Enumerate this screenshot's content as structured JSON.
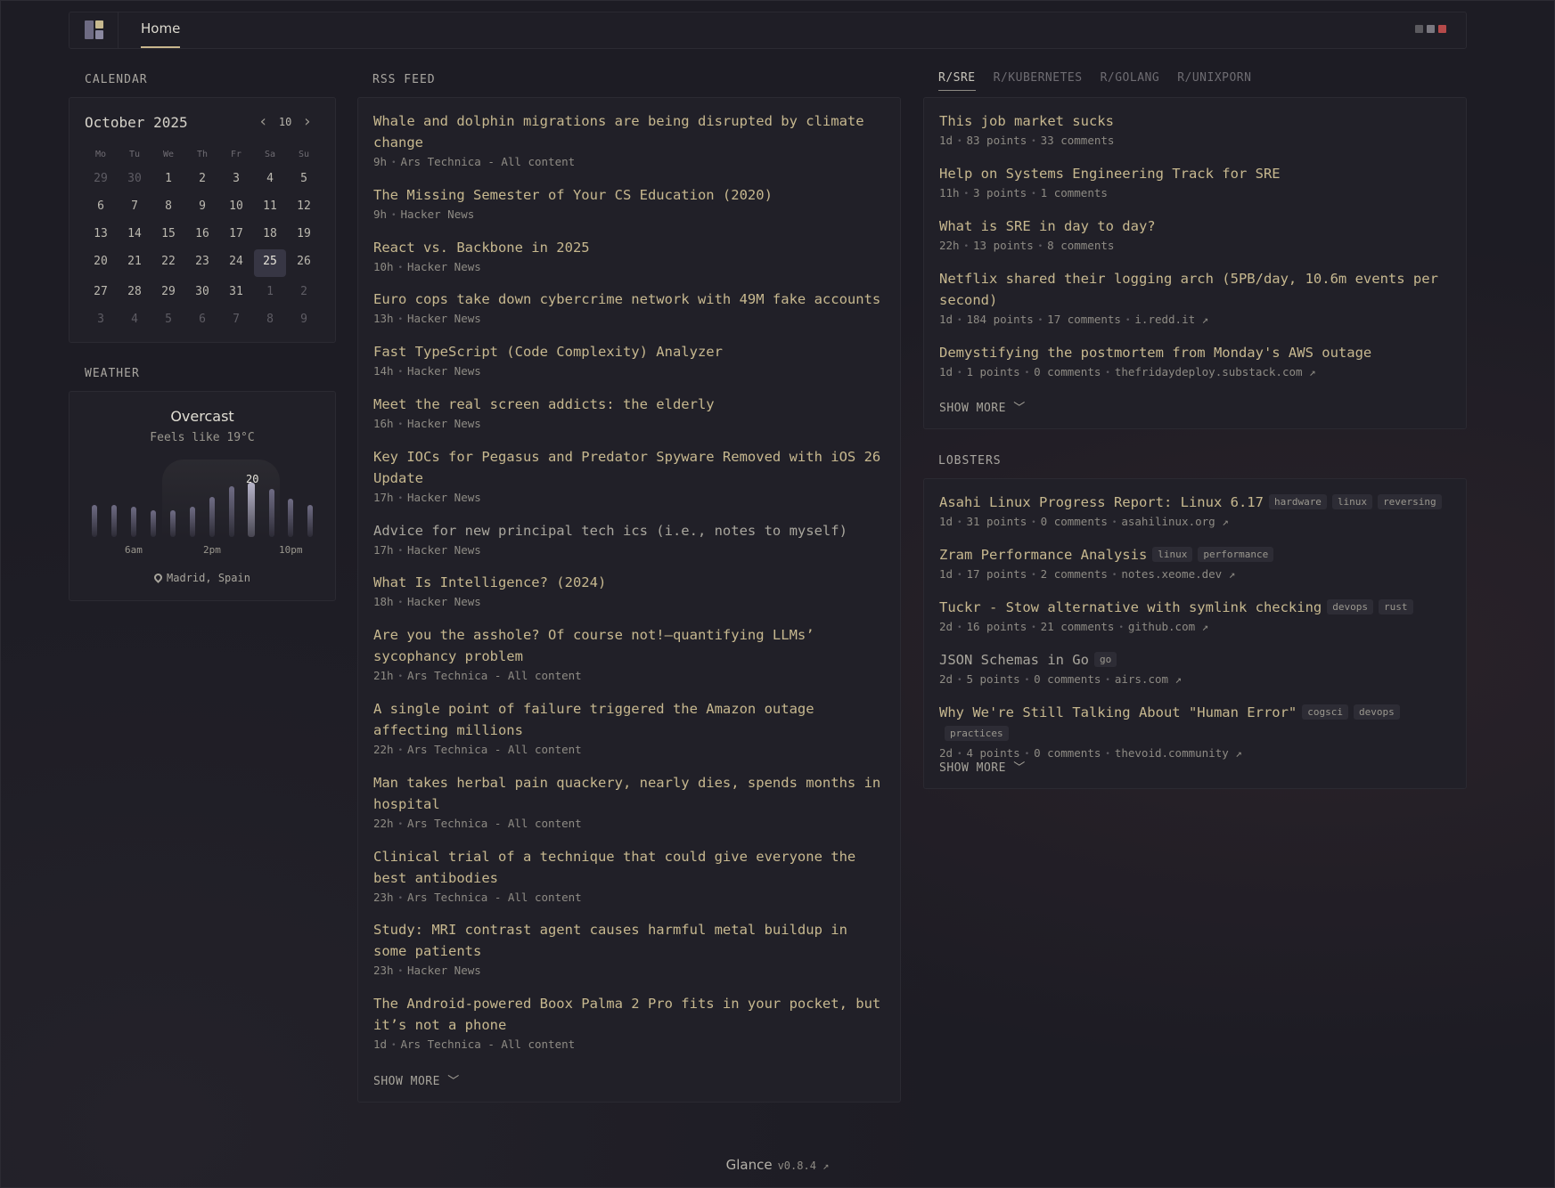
{
  "header": {
    "nav_home": "Home",
    "dot_colors": [
      "#5b5a5f",
      "#7a7880",
      "#b54a4a"
    ]
  },
  "calendar": {
    "section_title": "CALENDAR",
    "month_label": "October 2025",
    "week_number": "10",
    "dow": [
      "Mo",
      "Tu",
      "We",
      "Th",
      "Fr",
      "Sa",
      "Su"
    ],
    "days": [
      {
        "n": "29",
        "muted": true
      },
      {
        "n": "30",
        "muted": true
      },
      {
        "n": "1"
      },
      {
        "n": "2"
      },
      {
        "n": "3"
      },
      {
        "n": "4"
      },
      {
        "n": "5"
      },
      {
        "n": "6"
      },
      {
        "n": "7"
      },
      {
        "n": "8"
      },
      {
        "n": "9"
      },
      {
        "n": "10"
      },
      {
        "n": "11"
      },
      {
        "n": "12"
      },
      {
        "n": "13"
      },
      {
        "n": "14"
      },
      {
        "n": "15"
      },
      {
        "n": "16"
      },
      {
        "n": "17"
      },
      {
        "n": "18"
      },
      {
        "n": "19"
      },
      {
        "n": "20"
      },
      {
        "n": "21"
      },
      {
        "n": "22"
      },
      {
        "n": "23"
      },
      {
        "n": "24"
      },
      {
        "n": "25",
        "today": true
      },
      {
        "n": "26"
      },
      {
        "n": "27"
      },
      {
        "n": "28"
      },
      {
        "n": "29"
      },
      {
        "n": "30"
      },
      {
        "n": "31"
      },
      {
        "n": "1",
        "muted": true
      },
      {
        "n": "2",
        "muted": true
      },
      {
        "n": "3",
        "muted": true
      },
      {
        "n": "4",
        "muted": true
      },
      {
        "n": "5",
        "muted": true
      },
      {
        "n": "6",
        "muted": true
      },
      {
        "n": "7",
        "muted": true
      },
      {
        "n": "8",
        "muted": true
      },
      {
        "n": "9",
        "muted": true
      }
    ]
  },
  "weather": {
    "section_title": "WEATHER",
    "condition": "Overcast",
    "feels_like": "Feels like 19°C",
    "current_temp": "20",
    "hour_labels": [
      "6am",
      "2pm",
      "10pm"
    ],
    "hourly_levels": [
      0.45,
      0.45,
      0.4,
      0.3,
      0.3,
      0.4,
      0.65,
      0.9,
      1.0,
      0.85,
      0.6,
      0.45
    ],
    "current_index": 8,
    "location": "Madrid, Spain"
  },
  "rss": {
    "section_title": "RSS FEED",
    "items": [
      {
        "title": "Whale and dolphin migrations are being disrupted by climate change",
        "age": "9h",
        "source": "Ars Technica - All content"
      },
      {
        "title": "The Missing Semester of Your CS Education (2020)",
        "age": "9h",
        "source": "Hacker News"
      },
      {
        "title": "React vs. Backbone in 2025",
        "age": "10h",
        "source": "Hacker News"
      },
      {
        "title": "Euro cops take down cybercrime network with 49M fake accounts",
        "age": "13h",
        "source": "Hacker News"
      },
      {
        "title": "Fast TypeScript (Code Complexity) Analyzer",
        "age": "14h",
        "source": "Hacker News"
      },
      {
        "title": "Meet the real screen addicts: the elderly",
        "age": "16h",
        "source": "Hacker News"
      },
      {
        "title": "Key IOCs for Pegasus and Predator Spyware Removed with iOS 26 Update",
        "age": "17h",
        "source": "Hacker News"
      },
      {
        "title": "Advice for new principal tech ics (i.e., notes to myself)",
        "age": "17h",
        "source": "Hacker News",
        "visited": true
      },
      {
        "title": "What Is Intelligence? (2024)",
        "age": "18h",
        "source": "Hacker News"
      },
      {
        "title": "Are you the asshole? Of course not!—quantifying LLMs’ sycophancy problem",
        "age": "21h",
        "source": "Ars Technica - All content"
      },
      {
        "title": "A single point of failure triggered the Amazon outage affecting millions",
        "age": "22h",
        "source": "Ars Technica - All content"
      },
      {
        "title": "Man takes herbal pain quackery, nearly dies, spends months in hospital",
        "age": "22h",
        "source": "Ars Technica - All content"
      },
      {
        "title": "Clinical trial of a technique that could give everyone the best antibodies",
        "age": "23h",
        "source": "Ars Technica - All content"
      },
      {
        "title": "Study: MRI contrast agent causes harmful metal buildup in some patients",
        "age": "23h",
        "source": "Hacker News"
      },
      {
        "title": "The Android-powered Boox Palma 2 Pro fits in your pocket, but it’s not a phone",
        "age": "1d",
        "source": "Ars Technica - All content"
      }
    ],
    "show_more": "SHOW MORE"
  },
  "reddit": {
    "tabs": [
      "R/SRE",
      "R/KUBERNETES",
      "R/GOLANG",
      "R/UNIXPORN"
    ],
    "items": [
      {
        "title": "This job market sucks",
        "age": "1d",
        "points": "83 points",
        "comments": "33 comments"
      },
      {
        "title": "Help on Systems Engineering Track for SRE",
        "age": "11h",
        "points": "3 points",
        "comments": "1 comments"
      },
      {
        "title": "What is SRE in day to day?",
        "age": "22h",
        "points": "13 points",
        "comments": "8 comments"
      },
      {
        "title": "Netflix shared their logging arch (5PB/day, 10.6m events per second)",
        "age": "1d",
        "points": "184 points",
        "comments": "17 comments",
        "link": "i.redd.it ↗"
      },
      {
        "title": "Demystifying the postmortem from Monday's AWS outage",
        "age": "1d",
        "points": "1 points",
        "comments": "0 comments",
        "link": "thefridaydeploy.substack.com ↗"
      }
    ],
    "show_more": "SHOW MORE"
  },
  "lobsters": {
    "section_title": "LOBSTERS",
    "items": [
      {
        "title": "Asahi Linux Progress Report: Linux 6.17",
        "tags": [
          "hardware",
          "linux",
          "reversing"
        ],
        "age": "1d",
        "points": "31 points",
        "comments": "0 comments",
        "link": "asahilinux.org ↗"
      },
      {
        "title": "Zram Performance Analysis",
        "tags": [
          "linux",
          "performance"
        ],
        "age": "1d",
        "points": "17 points",
        "comments": "2 comments",
        "link": "notes.xeome.dev ↗"
      },
      {
        "title": "Tuckr - Stow alternative with symlink checking",
        "tags": [
          "devops",
          "rust"
        ],
        "age": "2d",
        "points": "16 points",
        "comments": "21 comments",
        "link": "github.com ↗"
      },
      {
        "title": "JSON Schemas in Go",
        "tags": [
          "go"
        ],
        "age": "2d",
        "points": "5 points",
        "comments": "0 comments",
        "link": "airs.com ↗",
        "visited": true
      },
      {
        "title": "Why We're Still Talking About \"Human Error\"",
        "tags": [
          "cogsci",
          "devops",
          "practices"
        ],
        "age": "2d",
        "points": "4 points",
        "comments": "0 comments",
        "link": "thevoid.community ↗"
      }
    ],
    "show_more": "SHOW MORE"
  },
  "footer": {
    "app_name": "Glance",
    "version": "v0.8.4 ↗"
  }
}
